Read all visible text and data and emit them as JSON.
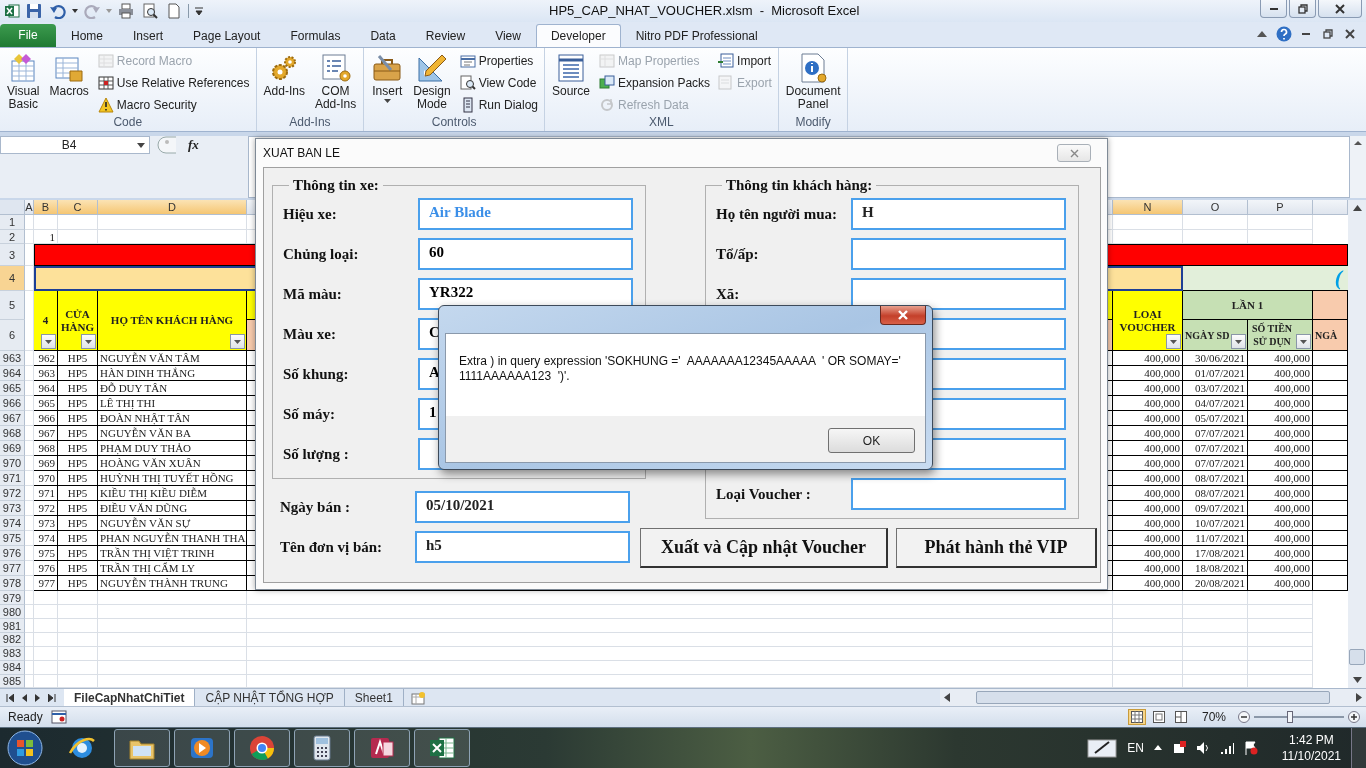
{
  "window": {
    "title": "HP5_CAP_NHAT_VOUCHER.xlsm  -  Microsoft Excel"
  },
  "ribbon_tabs": [
    {
      "label": "File",
      "kind": "file",
      "selected": false
    },
    {
      "label": "Home",
      "kind": "tab",
      "selected": false
    },
    {
      "label": "Insert",
      "kind": "tab",
      "selected": false
    },
    {
      "label": "Page Layout",
      "kind": "tab",
      "selected": false
    },
    {
      "label": "Formulas",
      "kind": "tab",
      "selected": false
    },
    {
      "label": "Data",
      "kind": "tab",
      "selected": false
    },
    {
      "label": "Review",
      "kind": "tab",
      "selected": false
    },
    {
      "label": "View",
      "kind": "tab",
      "selected": false
    },
    {
      "label": "Developer",
      "kind": "tab",
      "selected": true
    },
    {
      "label": "Nitro PDF Professional",
      "kind": "tab",
      "selected": false
    }
  ],
  "ribbon_groups": [
    {
      "label": "Code",
      "items": [
        {
          "label": "Visual\nBasic",
          "kind": "large",
          "disabled": false
        },
        {
          "label": "Macros",
          "kind": "large",
          "disabled": false
        },
        {
          "label": "Record Macro",
          "kind": "small",
          "disabled": true
        },
        {
          "label": "Use Relative References",
          "kind": "small",
          "disabled": false
        },
        {
          "label": "Macro Security",
          "kind": "small",
          "disabled": false
        }
      ]
    },
    {
      "label": "Add-Ins",
      "items": [
        {
          "label": "Add-Ins",
          "kind": "large",
          "disabled": false
        },
        {
          "label": "COM\nAdd-Ins",
          "kind": "large",
          "disabled": false
        }
      ]
    },
    {
      "label": "Controls",
      "items": [
        {
          "label": "Insert",
          "kind": "menu",
          "disabled": false
        },
        {
          "label": "Design\nMode",
          "kind": "large",
          "disabled": false
        },
        {
          "label": "Properties",
          "kind": "small",
          "disabled": false
        },
        {
          "label": "View Code",
          "kind": "small",
          "disabled": false
        },
        {
          "label": "Run Dialog",
          "kind": "small",
          "disabled": false
        }
      ]
    },
    {
      "label": "XML",
      "items": [
        {
          "label": "Source",
          "kind": "large",
          "disabled": false
        },
        {
          "label": "Map Properties",
          "kind": "small",
          "disabled": true
        },
        {
          "label": "Expansion Packs",
          "kind": "small",
          "disabled": false
        },
        {
          "label": "Refresh Data",
          "kind": "small",
          "disabled": true
        },
        {
          "label": "Import",
          "kind": "small",
          "disabled": false
        },
        {
          "label": "Export",
          "kind": "small",
          "disabled": true
        }
      ]
    },
    {
      "label": "Modify",
      "items": [
        {
          "label": "Document\nPanel",
          "kind": "large",
          "disabled": false
        }
      ]
    }
  ],
  "formula_bar": {
    "name_box": "B4",
    "insert_function": "fx"
  },
  "sheet": {
    "columns": [
      {
        "label": "A",
        "selected": false
      },
      {
        "label": "B",
        "selected": true
      },
      {
        "label": "C",
        "selected": true
      },
      {
        "label": "D",
        "selected": true
      },
      {
        "label": "N",
        "selected": true
      },
      {
        "label": "O",
        "selected": false
      },
      {
        "label": "P",
        "selected": false
      }
    ],
    "top_rows": [
      {
        "label": "1",
        "selected": false
      },
      {
        "label": "2",
        "selected": false
      },
      {
        "label": "3",
        "selected": false
      },
      {
        "label": "4",
        "selected": true
      },
      {
        "label": "5",
        "selected": false
      },
      {
        "label": "6",
        "selected": false
      }
    ],
    "b2": "1",
    "banner_fragment": "(",
    "headers": {
      "b": "4",
      "c": "CỬA HÀNG",
      "d": "HỌ TÊN KHÁCH HÀNG",
      "n": "LOẠI VOUCHER",
      "round": "LẦN 1",
      "o": "NGÀY SD",
      "p": "SỐ TIỀN SỬ DỤN",
      "q": "NGÀ"
    },
    "rows": [
      {
        "row": "963",
        "b": "962",
        "c": "HP5",
        "d": "NGUYỄN VĂN TÂM",
        "n": "400,000",
        "o": "30/06/2021",
        "p": "400,000"
      },
      {
        "row": "964",
        "b": "963",
        "c": "HP5",
        "d": "HÀN DINH THẮNG",
        "n": "400,000",
        "o": "01/07/2021",
        "p": "400,000"
      },
      {
        "row": "965",
        "b": "964",
        "c": "HP5",
        "d": "ĐỖ DUY TÂN",
        "n": "400,000",
        "o": "03/07/2021",
        "p": "400,000"
      },
      {
        "row": "966",
        "b": "965",
        "c": "HP5",
        "d": "LÊ THỊ THI",
        "n": "400,000",
        "o": "04/07/2021",
        "p": "400,000"
      },
      {
        "row": "967",
        "b": "966",
        "c": "HP5",
        "d": "ĐOÀN NHẬT TÂN",
        "n": "400,000",
        "o": "05/07/2021",
        "p": "400,000"
      },
      {
        "row": "968",
        "b": "967",
        "c": "HP5",
        "d": "NGUYỄN VĂN BA",
        "n": "400,000",
        "o": "07/07/2021",
        "p": "400,000"
      },
      {
        "row": "969",
        "b": "968",
        "c": "HP5",
        "d": "PHẠM DUY THẢO",
        "n": "400,000",
        "o": "07/07/2021",
        "p": "400,000"
      },
      {
        "row": "970",
        "b": "969",
        "c": "HP5",
        "d": "HOÀNG VĂN XUÂN",
        "n": "400,000",
        "o": "07/07/2021",
        "p": "400,000"
      },
      {
        "row": "971",
        "b": "970",
        "c": "HP5",
        "d": "HUỲNH THỊ TUYẾT HỒNG",
        "n": "400,000",
        "o": "08/07/2021",
        "p": "400,000"
      },
      {
        "row": "972",
        "b": "971",
        "c": "HP5",
        "d": "KIỀU THỊ KIỀU DIỄM",
        "n": "400,000",
        "o": "08/07/2021",
        "p": "400,000"
      },
      {
        "row": "973",
        "b": "972",
        "c": "HP5",
        "d": "ĐIỀU VĂN DŨNG",
        "n": "400,000",
        "o": "09/07/2021",
        "p": "400,000"
      },
      {
        "row": "974",
        "b": "973",
        "c": "HP5",
        "d": "NGUYỄN VĂN SỰ",
        "n": "400,000",
        "o": "10/07/2021",
        "p": "400,000"
      },
      {
        "row": "975",
        "b": "974",
        "c": "HP5",
        "d": "PHAN NGUYỄN THANH THA",
        "n": "400,000",
        "o": "11/07/2021",
        "p": "400,000"
      },
      {
        "row": "976",
        "b": "975",
        "c": "HP5",
        "d": "TRẦN THỊ VIỆT TRINH",
        "n": "400,000",
        "o": "17/08/2021",
        "p": "400,000"
      },
      {
        "row": "977",
        "b": "976",
        "c": "HP5",
        "d": "TRẦN THỊ CẨM LY",
        "n": "400,000",
        "o": "18/08/2021",
        "p": "400,000"
      },
      {
        "row": "978",
        "b": "977",
        "c": "HP5",
        "d": "NGUYỄN THÀNH TRUNG",
        "n": "400,000",
        "o": "20/08/2021",
        "p": "400,000"
      }
    ],
    "empty_rows": [
      "979",
      "980",
      "981",
      "982",
      "983",
      "984",
      "985"
    ]
  },
  "sheet_tabs": [
    {
      "label": "FileCapNhatChiTiet",
      "selected": true
    },
    {
      "label": "CẬP NHẬT TỔNG HỢP",
      "selected": false
    },
    {
      "label": "Sheet1",
      "selected": false
    }
  ],
  "status_bar": {
    "status": "Ready",
    "views": [
      {
        "selected": true
      },
      {
        "selected": false
      },
      {
        "selected": false
      }
    ],
    "zoom": "70%",
    "zoom_slider": {
      "level": 0.4
    }
  },
  "form": {
    "title": "XUAT BAN LE",
    "vehicle": {
      "legend": "Thông tin xe:",
      "fields": [
        {
          "label": "Hiệu xe:",
          "value": "Air Blade",
          "color": "#3b8fe8"
        },
        {
          "label": "Chủng loại:",
          "value": "60",
          "color": "#000000"
        },
        {
          "label": "Mã màu:",
          "value": "YR322",
          "color": "#000000"
        },
        {
          "label": "Màu xe:",
          "value": "C",
          "color": "#000000"
        },
        {
          "label": "Số khung:",
          "value": "A",
          "color": "#000000"
        },
        {
          "label": "Số máy:",
          "value": "1",
          "color": "#000000"
        },
        {
          "label": "Số lượng :"
        }
      ]
    },
    "customer": {
      "legend": "Thông tin khách hàng:",
      "fields": [
        {
          "kind": "text",
          "label": "Họ tên người mua:",
          "value": "H"
        },
        {
          "kind": "text",
          "label": "Tổ/ấp:"
        },
        {
          "kind": "text",
          "label": "Xã:"
        },
        {
          "kind": "text"
        },
        {
          "kind": "text"
        },
        {
          "kind": "text"
        },
        {
          "kind": "text"
        },
        {
          "kind": "text",
          "label": "Loại Voucher :"
        }
      ]
    },
    "sale_date": {
      "label": "Ngày bán :",
      "value": "05/10/2021"
    },
    "seller": {
      "label": "Tên đơn vị bán:",
      "value": "h5"
    },
    "buttons": [
      "Xuất và Cập nhật Voucher",
      "Phát hành thẻ VIP"
    ]
  },
  "message_box": {
    "message": "Extra ) in query expression 'SOKHUNG ='  AAAAAAA12345AAAAA  ' OR SOMAY=' 1111AAAAAA123  ')'.",
    "button": "OK"
  },
  "taskbar": {
    "apps": [
      {
        "running": false
      },
      {
        "running": true
      },
      {
        "running": true
      },
      {
        "running": true
      },
      {
        "running": true
      },
      {
        "running": true
      },
      {
        "running": true
      }
    ],
    "language": "EN",
    "time": "1:42 PM",
    "date": "11/10/2021"
  }
}
